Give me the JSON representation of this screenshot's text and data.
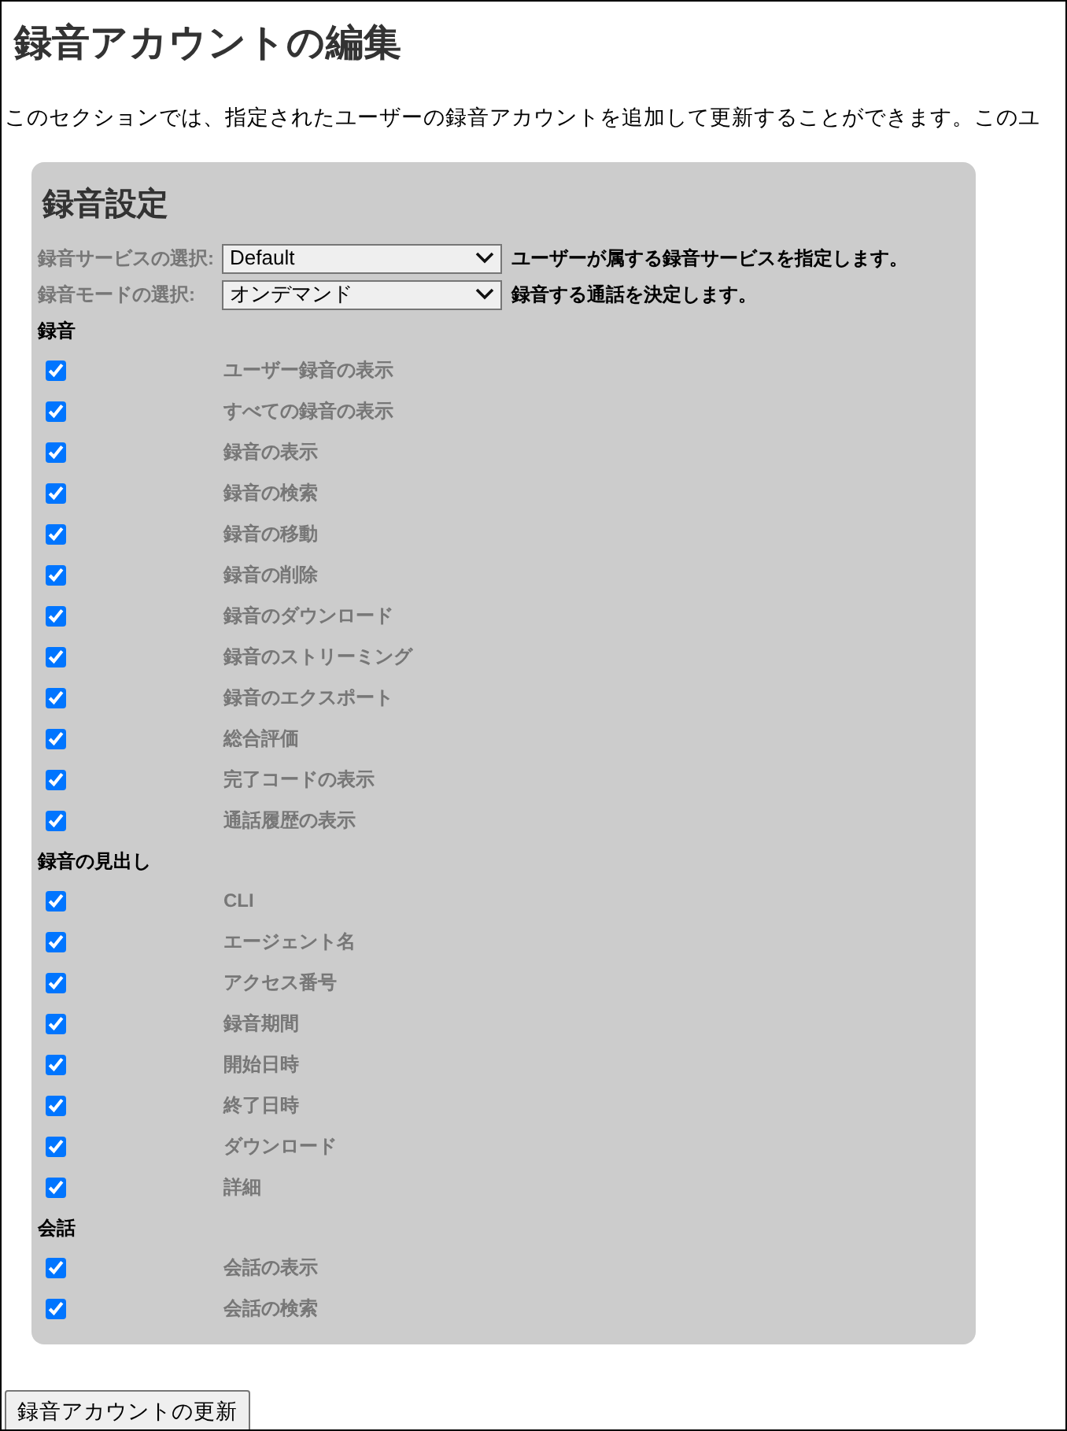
{
  "title": "録音アカウントの編集",
  "intro": "このセクションでは、指定されたユーザーの録音アカウントを追加して更新することができます。このユ",
  "panel": {
    "title": "録音設定",
    "settings": [
      {
        "label": "録音サービスの選択:",
        "value": "Default",
        "description": "ユーザーが属する録音サービスを指定します。"
      },
      {
        "label": "録音モードの選択:",
        "value": "オンデマンド",
        "description": "録音する通話を決定します。"
      }
    ],
    "sections": [
      {
        "heading": "録音",
        "items": [
          {
            "label": "ユーザー録音の表示",
            "checked": true
          },
          {
            "label": "すべての録音の表示",
            "checked": true
          },
          {
            "label": "録音の表示",
            "checked": true
          },
          {
            "label": "録音の検索",
            "checked": true
          },
          {
            "label": "録音の移動",
            "checked": true
          },
          {
            "label": "録音の削除",
            "checked": true
          },
          {
            "label": "録音のダウンロード",
            "checked": true
          },
          {
            "label": "録音のストリーミング",
            "checked": true
          },
          {
            "label": "録音のエクスポート",
            "checked": true
          },
          {
            "label": "総合評価",
            "checked": true
          },
          {
            "label": "完了コードの表示",
            "checked": true
          },
          {
            "label": "通話履歴の表示",
            "checked": true
          }
        ]
      },
      {
        "heading": "録音の見出し",
        "items": [
          {
            "label": "CLI",
            "checked": true
          },
          {
            "label": "エージェント名",
            "checked": true
          },
          {
            "label": "アクセス番号",
            "checked": true
          },
          {
            "label": "録音期間",
            "checked": true
          },
          {
            "label": "開始日時",
            "checked": true
          },
          {
            "label": "終了日時",
            "checked": true
          },
          {
            "label": "ダウンロード",
            "checked": true
          },
          {
            "label": "詳細",
            "checked": true
          }
        ]
      },
      {
        "heading": "会話",
        "items": [
          {
            "label": "会話の表示",
            "checked": true
          },
          {
            "label": "会話の検索",
            "checked": true
          }
        ]
      }
    ]
  },
  "submit_button": "録音アカウントの更新"
}
